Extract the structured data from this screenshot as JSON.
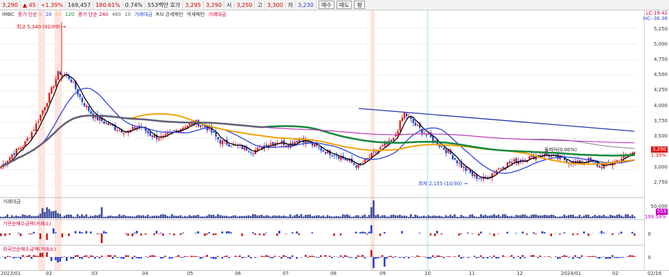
{
  "topbar": {
    "price": "3,290",
    "change": "45",
    "change_rate": "+1.39%",
    "volume": "169,457",
    "volume_ratio": "180.61%",
    "turnover_rate": "0.74%",
    "quote_label": "553백만 호가",
    "ask": "3,295",
    "bid": "3,290",
    "open_label": "시",
    "open": "3,250",
    "high_label": "고",
    "high": "3,300",
    "low_label": "저",
    "low": "3,230",
    "buy_label": "매수",
    "sell_label": "매도",
    "flat_label": "평"
  },
  "legend": {
    "stock": "iMBC",
    "ma_short_label": "종가 단순 5",
    "ma_short_values": [
      "20",
      "60",
      "120"
    ],
    "ma_short_colors": [
      "#000000",
      "#2a3fd8",
      "#f0a000",
      "#168a3a"
    ],
    "ma_long_label": "종가 단순 240",
    "ma_long_values": [
      "480",
      "10"
    ],
    "volume_label": "거래대금",
    "rsi_label": "RSI 강세패턴",
    "weak_label": "약세패턴",
    "trade_label": "거래대금"
  },
  "main_yaxis": {
    "labels": [
      "5,250",
      "5,000",
      "4,750",
      "4,500",
      "4,250",
      "4,000",
      "3,750",
      "3,500",
      "3,250",
      "3,000",
      "2,750"
    ],
    "top_values": [
      "LC:19.42",
      "HC:-36.36"
    ],
    "current_price": "3,290",
    "current_change": "1.39%"
  },
  "annotations": {
    "high": "최고 5,340 (02/09) →",
    "low": "최저 2,155 (10/30) →",
    "breakout": "돌파덕(0.00%)"
  },
  "panels": {
    "volume_title": "거래대금",
    "volume_axis": [
      "50,000",
      "0"
    ],
    "volume_current": "553",
    "volume_pct": "199.54%",
    "inst_title": "기관순매수금액(거래소)",
    "inst_axis": [
      "0"
    ],
    "foreign_title": "외국인순매수금액(거래소)",
    "foreign_axis": [
      "0"
    ]
  },
  "xaxis": {
    "labels": [
      "2023/01",
      "02",
      "03",
      "04",
      "05",
      "06",
      "07",
      "08",
      "09",
      "10",
      "11",
      "12",
      "2024/01",
      "02",
      "02/16"
    ]
  },
  "chart_data": {
    "type": "candlestick",
    "title": "iMBC",
    "period": "2023/01 - 2024/02",
    "y_range": [
      2700,
      5400
    ],
    "high": {
      "value": 5340,
      "date": "02/09"
    },
    "low": {
      "value": 2155,
      "date": "10/30"
    },
    "close_path": [
      3050,
      3250,
      3400,
      3700,
      4100,
      4550,
      4450,
      4100,
      3850,
      3750,
      3650,
      3600,
      3700,
      3550,
      3500,
      3600,
      3700,
      3750,
      3650,
      3450,
      3400,
      3350,
      3300,
      3400,
      3450,
      3400,
      3500,
      3400,
      3300,
      3250,
      3150,
      3050,
      3200,
      3350,
      3450,
      3900,
      3700,
      3550,
      3400,
      3250,
      3050,
      2900,
      2850,
      3000,
      3100,
      3150,
      3200,
      3250,
      3200,
      3150,
      3100,
      3150,
      3050,
      3100,
      3200,
      3290
    ]
  }
}
